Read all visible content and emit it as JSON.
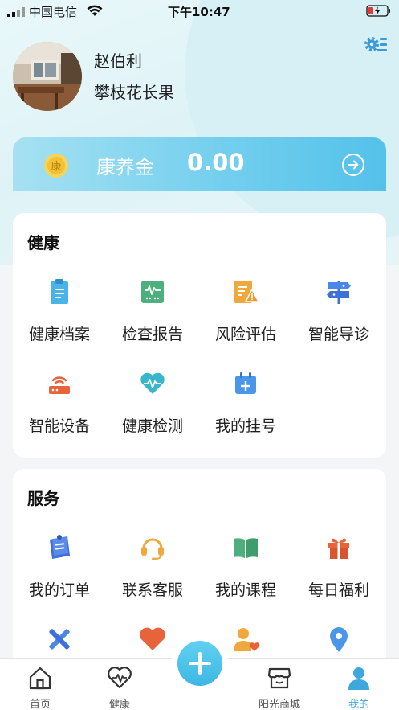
{
  "status_bar": {
    "carrier": "中国电信",
    "time": "下午10:47"
  },
  "profile": {
    "name": "赵伯利",
    "motto": "攀枝花长果"
  },
  "wallet": {
    "label": "康养金",
    "value": "0.00",
    "coin_char": "康"
  },
  "health": {
    "title": "健康",
    "items": [
      {
        "label": "健康档案",
        "icon": "clipboard-icon"
      },
      {
        "label": "检查报告",
        "icon": "report-chart-icon"
      },
      {
        "label": "风险评估",
        "icon": "risk-warning-icon"
      },
      {
        "label": "智能导诊",
        "icon": "signpost-icon"
      },
      {
        "label": "智能设备",
        "icon": "router-device-icon"
      },
      {
        "label": "健康检测",
        "icon": "heart-pulse-icon"
      },
      {
        "label": "我的挂号",
        "icon": "calendar-plus-icon"
      }
    ]
  },
  "service": {
    "title": "服务",
    "items": [
      {
        "label": "我的订单",
        "icon": "order-note-icon"
      },
      {
        "label": "联系客服",
        "icon": "headset-icon"
      },
      {
        "label": "我的课程",
        "icon": "book-icon"
      },
      {
        "label": "每日福利",
        "icon": "gift-icon"
      },
      {
        "icon": "tools-icon"
      },
      {
        "icon": "heart-icon"
      },
      {
        "icon": "user-heart-icon"
      },
      {
        "icon": "location-pin-icon"
      }
    ]
  },
  "tabs": [
    {
      "label": "首页",
      "icon": "home-icon"
    },
    {
      "label": "健康",
      "icon": "health-heart-icon"
    },
    {
      "label": "",
      "icon": "plus-icon"
    },
    {
      "label": "阳光商城",
      "icon": "store-icon"
    },
    {
      "label": "我的",
      "icon": "profile-icon"
    }
  ],
  "colors": {
    "accent": "#3ea8dc",
    "coin_gold": "#f6c94a",
    "icon_blue": "#4aa8e8",
    "icon_green": "#4caf7d",
    "icon_orange": "#f0a83c",
    "icon_red": "#e8633a"
  }
}
